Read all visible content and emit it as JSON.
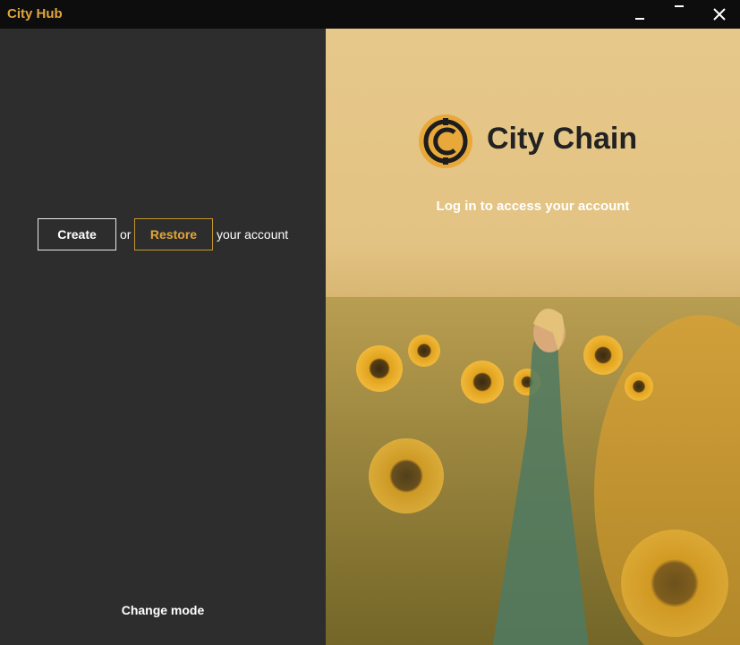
{
  "window": {
    "title": "City Hub",
    "minimize_icon": "minimize-icon",
    "maximize_icon": "maximize-icon",
    "close_icon": "close-icon"
  },
  "left": {
    "create_label": "Create",
    "or_text": "or",
    "restore_label": "Restore",
    "suffix_text": "your account",
    "change_mode_label": "Change mode"
  },
  "right": {
    "brand_name": "City Chain",
    "logo_icon": "city-chain-logo-icon",
    "tagline": "Log in to access your account",
    "background_image": "woman in sunflower field"
  },
  "colors": {
    "accent": "#e2a63a",
    "panel_bg": "#2d2d2d",
    "titlebar_bg": "#0d0d0d"
  }
}
